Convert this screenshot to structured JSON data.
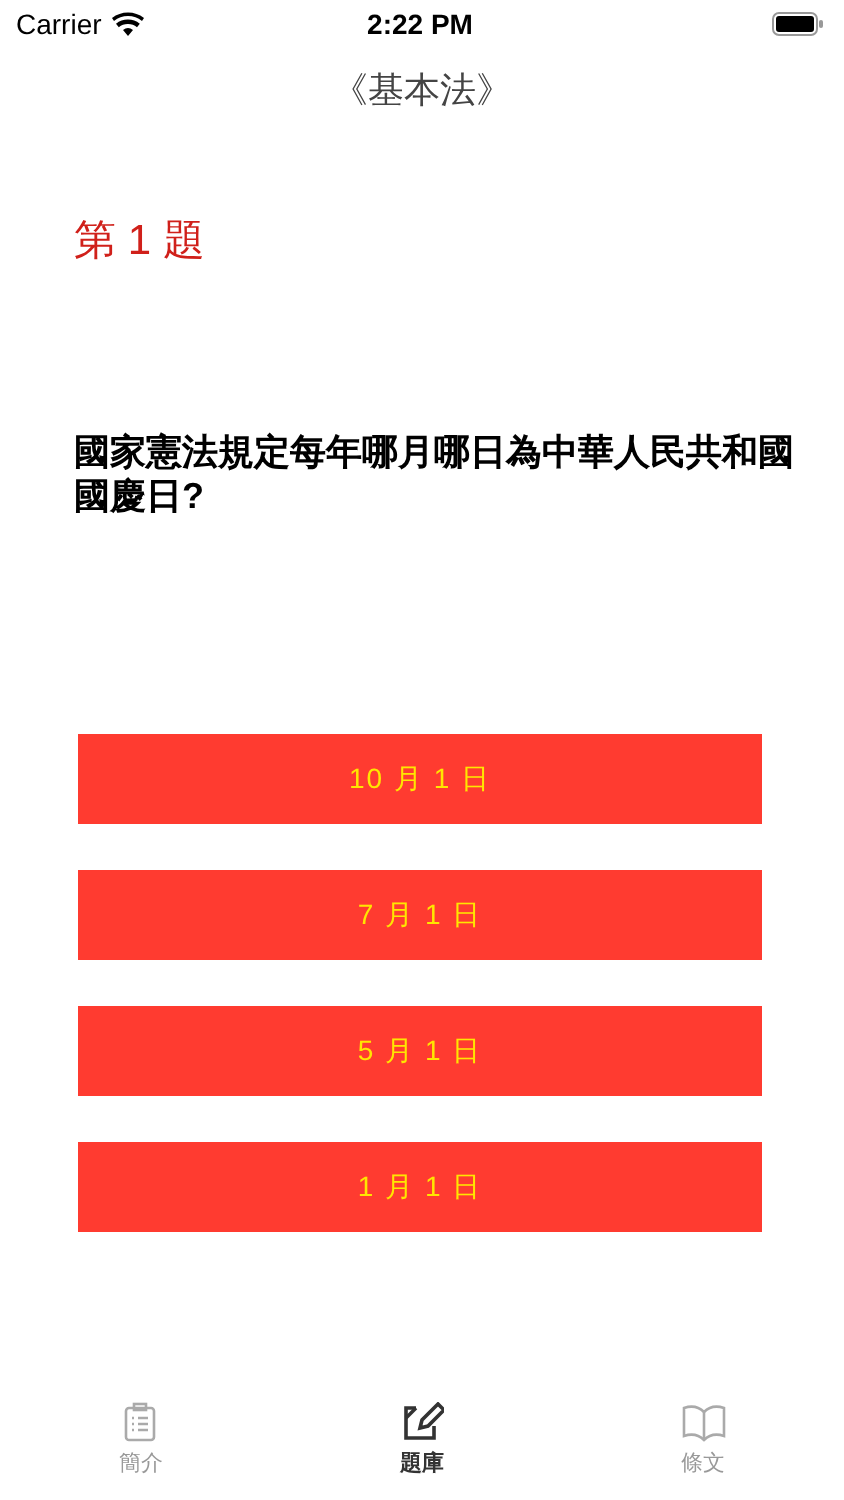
{
  "status_bar": {
    "carrier": "Carrier",
    "time": "2:22 PM"
  },
  "nav": {
    "title": "《基本法》"
  },
  "question": {
    "number": "第 1 題",
    "text": "國家憲法規定每年哪月哪日為中華人民共和國國慶日?"
  },
  "answers": [
    "10 月 1 日",
    "7 月 1 日",
    "5 月 1 日",
    "1 月 1 日"
  ],
  "tabs": [
    {
      "label": "簡介",
      "kind": "clipboard",
      "selected": false
    },
    {
      "label": "題庫",
      "kind": "edit",
      "selected": true
    },
    {
      "label": "條文",
      "kind": "book",
      "selected": false
    }
  ]
}
